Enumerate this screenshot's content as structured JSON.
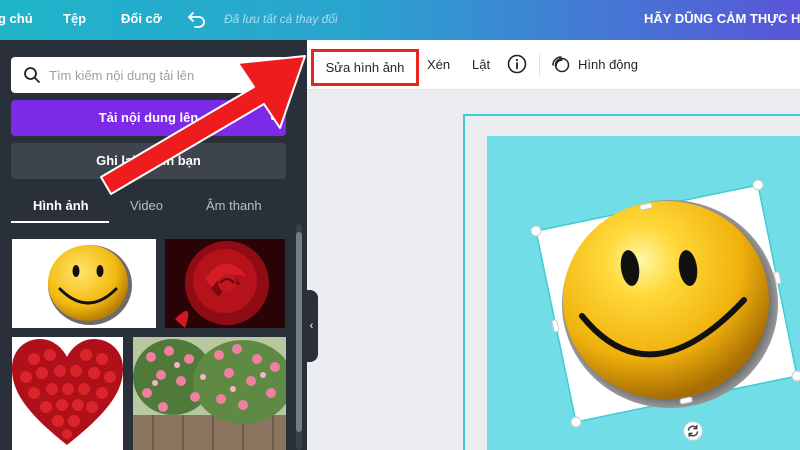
{
  "topbar": {
    "home_label": "g chủ",
    "file_label": "Tệp",
    "resize_label": "Đổi cỡ",
    "undo_icon": "undo-icon",
    "saved_status": "Đã lưu tất cả thay đổi",
    "design_title": "HÃY DŨNG CẢM THỰC HIỆ"
  },
  "sidebar": {
    "search": {
      "placeholder": "Tìm kiếm nội dung tải lên",
      "value": ""
    },
    "upload_label": "Tải nội dung lên",
    "record_label": "Ghi lại chính bạn",
    "tabs": [
      {
        "label": "Hình ảnh",
        "active": true
      },
      {
        "label": "Video",
        "active": false
      },
      {
        "label": "Âm thanh",
        "active": false
      }
    ],
    "thumbnails": [
      "smiley-thumbnail",
      "red-rose-thumbnail",
      "rose-heart-thumbnail",
      "rose-garden-thumbnail"
    ],
    "collapse_glyph": "‹"
  },
  "toolbar": {
    "edit_image_label": "Sửa hình ảnh",
    "crop_label": "Xén",
    "flip_label": "Lật",
    "animate_label": "Hình động",
    "highlight_color": "#e8261f"
  },
  "colors": {
    "accent_purple": "#7d2ae8",
    "sidebar_bg": "#293039",
    "canvas_bg": "#71dde6",
    "selection": "#3ecbd6",
    "annotation_arrow": "#ee1c1c"
  }
}
